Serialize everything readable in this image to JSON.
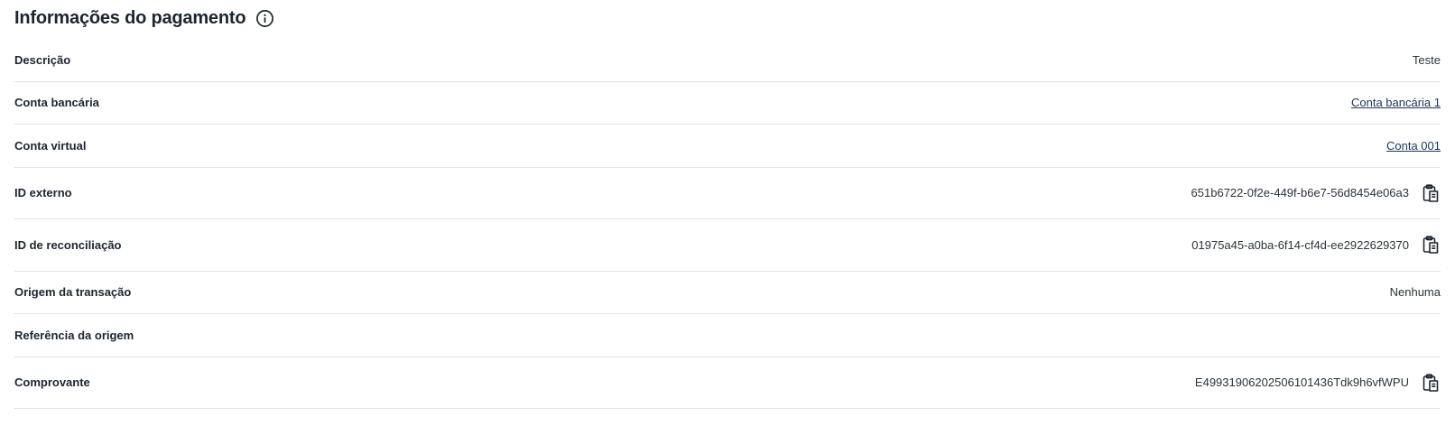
{
  "section": {
    "title": "Informações do pagamento",
    "info_icon": "info-circle-icon"
  },
  "rows": [
    {
      "label": "Descrição",
      "value": "Teste",
      "kind": "text"
    },
    {
      "label": "Conta bancária",
      "value": "Conta bancária 1",
      "kind": "link"
    },
    {
      "label": "Conta virtual",
      "value": "Conta 001",
      "kind": "link"
    },
    {
      "label": "ID externo",
      "value": "651b6722-0f2e-449f-b6e7-56d8454e06a3",
      "kind": "copy",
      "icon": "copy-icon"
    },
    {
      "label": "ID de reconciliação",
      "value": "01975a45-a0ba-6f14-cf4d-ee2922629370",
      "kind": "copy",
      "icon": "copy-icon"
    },
    {
      "label": "Origem da transação",
      "value": "Nenhuma",
      "kind": "text"
    },
    {
      "label": "Referência da origem",
      "value": "",
      "kind": "text"
    },
    {
      "label": "Comprovante",
      "value": "E49931906202506101436Tdk9h6vfWPU",
      "kind": "copy",
      "icon": "copy-icon"
    }
  ],
  "colors": {
    "text": "#1d2530",
    "divider": "#dfe2e6",
    "link": "#1d3557"
  }
}
